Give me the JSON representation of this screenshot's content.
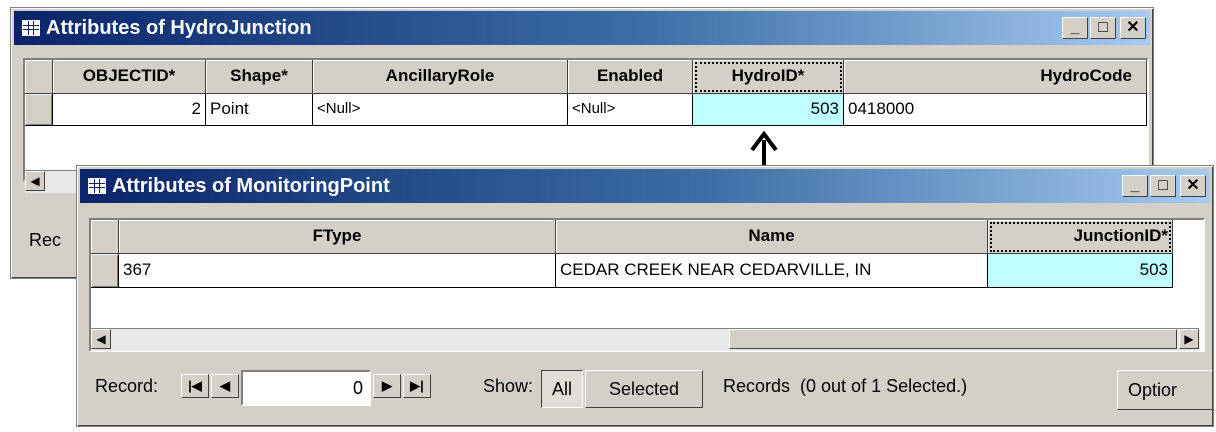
{
  "hydro_window": {
    "title": "Attributes of HydroJunction",
    "columns": [
      "OBJECTID*",
      "Shape*",
      "AncillaryRole",
      "Enabled",
      "HydroID*",
      "HydroCode"
    ],
    "row": [
      "2",
      "Point",
      "<Null>",
      "<Null>",
      "503",
      "0418000"
    ],
    "status_partial": "Rec"
  },
  "monitoring_window": {
    "title": "Attributes of MonitoringPoint",
    "columns": [
      "FType",
      "Name",
      "JunctionID*"
    ],
    "row": [
      "367",
      "CEDAR CREEK NEAR CEDARVILLE, IN",
      "503"
    ],
    "record_label": "Record:",
    "record_value": "0",
    "show_label": "Show:",
    "show_all": "All",
    "show_selected": "Selected",
    "records_status": "Records  (0 out of 1 Selected.)",
    "options_label": "Optior"
  },
  "window_buttons": {
    "minimize": "_",
    "maximize": "□",
    "close": "✕"
  },
  "colors": {
    "highlight": "#bfffff",
    "title_dark": "#0a246a",
    "face": "#d4d0c8"
  }
}
